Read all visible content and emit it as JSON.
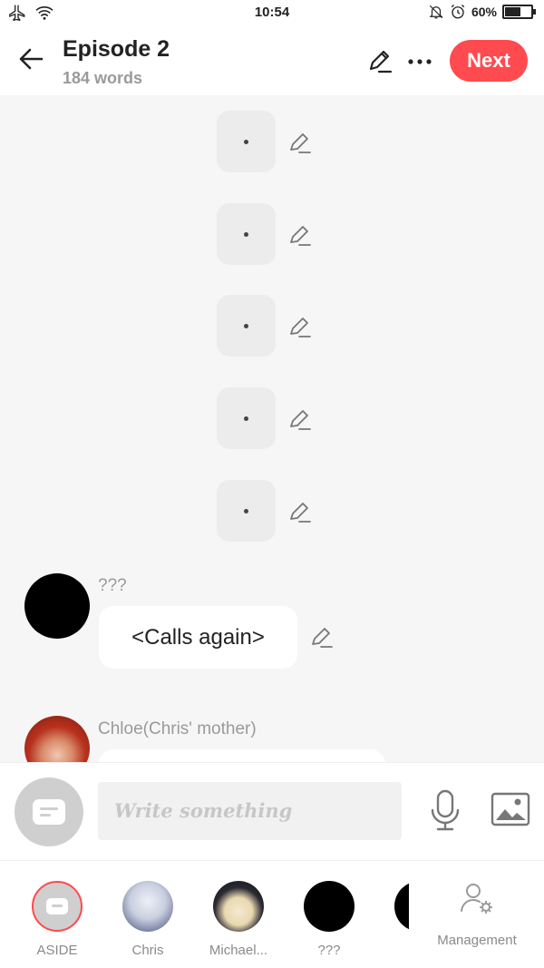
{
  "status_bar": {
    "time": "10:54",
    "battery_percent": "60%",
    "battery_level": 0.6
  },
  "header": {
    "title": "Episode 2",
    "subtitle": "184 words",
    "next_label": "Next",
    "accent_color": "#ff4a4f"
  },
  "chat": {
    "aside_messages": [
      {
        "text": "·"
      },
      {
        "text": "·"
      },
      {
        "text": "·"
      },
      {
        "text": "·"
      },
      {
        "text": "·"
      }
    ],
    "messages": [
      {
        "sender": "???",
        "text": "<Calls again>",
        "avatar_color": "#000000"
      },
      {
        "sender": "Chloe(Chris' mother)",
        "text": "",
        "avatar_color": "#b8321e"
      }
    ]
  },
  "input_bar": {
    "placeholder": "Write something",
    "icons": [
      "aside-toggle-icon",
      "microphone-icon",
      "image-icon"
    ]
  },
  "characters": [
    {
      "label": "ASIDE",
      "selected": true
    },
    {
      "label": "Chris",
      "selected": false
    },
    {
      "label": "Michael...",
      "selected": false
    },
    {
      "label": "???",
      "selected": false
    },
    {
      "label": "",
      "selected": false
    }
  ],
  "management_label": "Management"
}
